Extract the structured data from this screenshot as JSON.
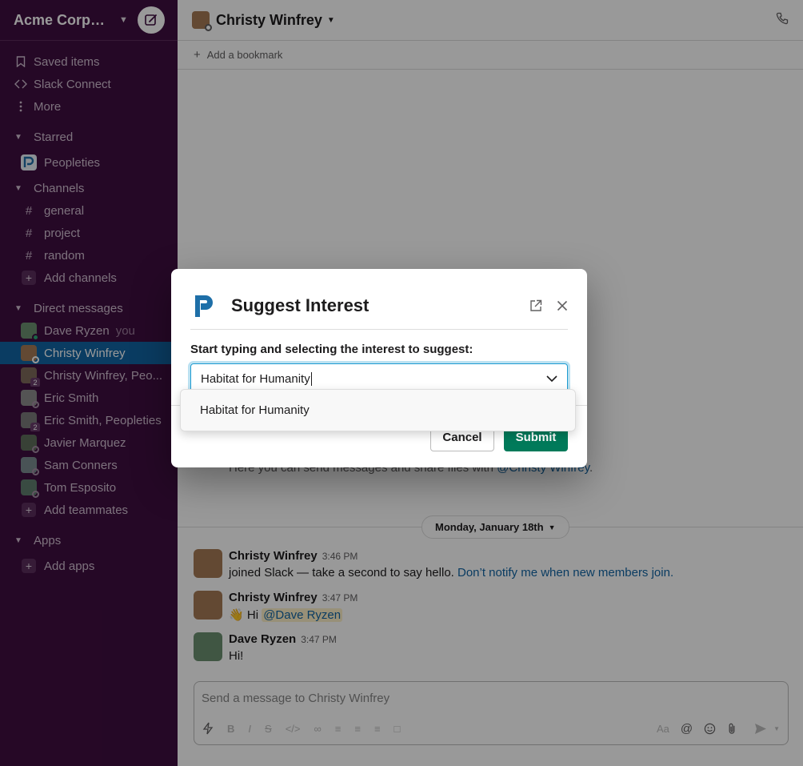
{
  "workspace": {
    "name": "Acme Corpor..."
  },
  "sidebar": {
    "top_items": [
      {
        "label": "Saved items",
        "icon": "bookmark-icon"
      },
      {
        "label": "Slack Connect",
        "icon": "slack-connect-icon"
      },
      {
        "label": "More",
        "icon": "more-vertical-icon"
      }
    ],
    "starred": {
      "title": "Starred",
      "items": [
        {
          "label": "Peopleties"
        }
      ]
    },
    "channels": {
      "title": "Channels",
      "items": [
        {
          "label": "general"
        },
        {
          "label": "project"
        },
        {
          "label": "random"
        }
      ],
      "add_label": "Add channels"
    },
    "dms": {
      "title": "Direct messages",
      "items": [
        {
          "label": "Dave Ryzen",
          "suffix": "you",
          "color": "#6b8f71"
        },
        {
          "label": "Christy Winfrey",
          "color": "#a57b55"
        },
        {
          "label": "Christy Winfrey, Peo...",
          "count": "2",
          "color": "#7d6a5a"
        },
        {
          "label": "Eric Smith",
          "color": "#8d8d8d"
        },
        {
          "label": "Eric Smith, Peopleties",
          "count": "2",
          "color": "#7a7a7a"
        },
        {
          "label": "Javier Marquez",
          "color": "#5e6d5a"
        },
        {
          "label": "Sam Conners",
          "color": "#7a8a8f"
        },
        {
          "label": "Tom Esposito",
          "color": "#5f7d6e"
        }
      ],
      "add_label": "Add teammates"
    },
    "apps": {
      "title": "Apps",
      "add_label": "Add apps"
    }
  },
  "channel": {
    "title": "Christy Winfrey",
    "bookmark_label": "Add a bookmark"
  },
  "intro": {
    "text": "Here you can send messages and share files with ",
    "mention": "@Christy Winfrey",
    "end": "."
  },
  "date_divider": "Monday, January 18th",
  "messages": [
    {
      "author": "Christy Winfrey",
      "time": "3:46 PM",
      "text": "joined Slack — take a second to say hello. ",
      "link": "Don’t notify me when new members join."
    },
    {
      "author": "Christy Winfrey",
      "time": "3:47 PM",
      "emoji": "👋",
      "text": " Hi ",
      "mention": "@Dave Ryzen"
    },
    {
      "author": "Dave Ryzen",
      "time": "3:47 PM",
      "text": "Hi!"
    }
  ],
  "composer": {
    "placeholder": "Send a message to Christy Winfrey",
    "format_label": "Aa"
  },
  "modal": {
    "title": "Suggest Interest",
    "label": "Start typing and selecting the interest to suggest:",
    "input_value": "Habitat for Humanity",
    "dropdown_option": "Habitat for Humanity",
    "cancel_label": "Cancel",
    "submit_label": "Submit"
  },
  "colors": {
    "sidebar": "#3f0e40",
    "active": "#1264a3",
    "submit": "#007a5a",
    "focus": "#1d9bd1"
  }
}
